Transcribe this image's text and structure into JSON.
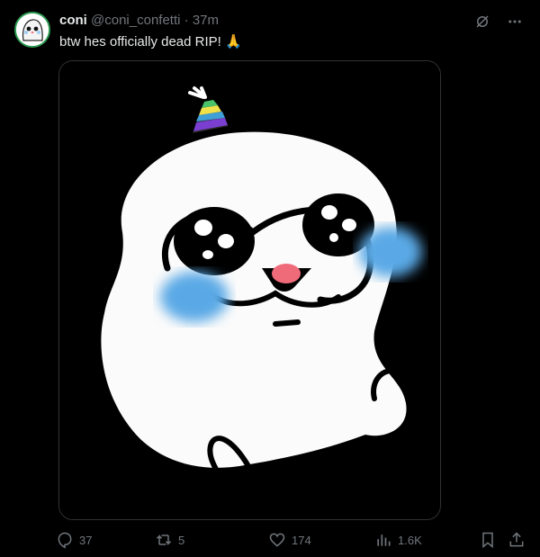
{
  "post": {
    "display_name": "coni",
    "handle": "@coni_confetti",
    "separator": "·",
    "time": "37m",
    "text": "btw hes officially dead RIP! 🙏"
  },
  "metrics": {
    "replies": "37",
    "reposts": "5",
    "likes": "174",
    "views": "1.6K"
  },
  "icons": {
    "top": [
      "grok-icon",
      "more-icon"
    ],
    "actions": [
      "reply-icon",
      "repost-icon",
      "like-icon",
      "views-icon",
      "bookmark-icon",
      "share-icon"
    ]
  },
  "colors": {
    "background": "#000000",
    "text": "#e7e9ea",
    "muted": "#71767b",
    "media_border": "#2f3336",
    "avatar_ring": "#2e9c53",
    "blush": "#5aa9e6",
    "nose": "#f06b7a"
  }
}
